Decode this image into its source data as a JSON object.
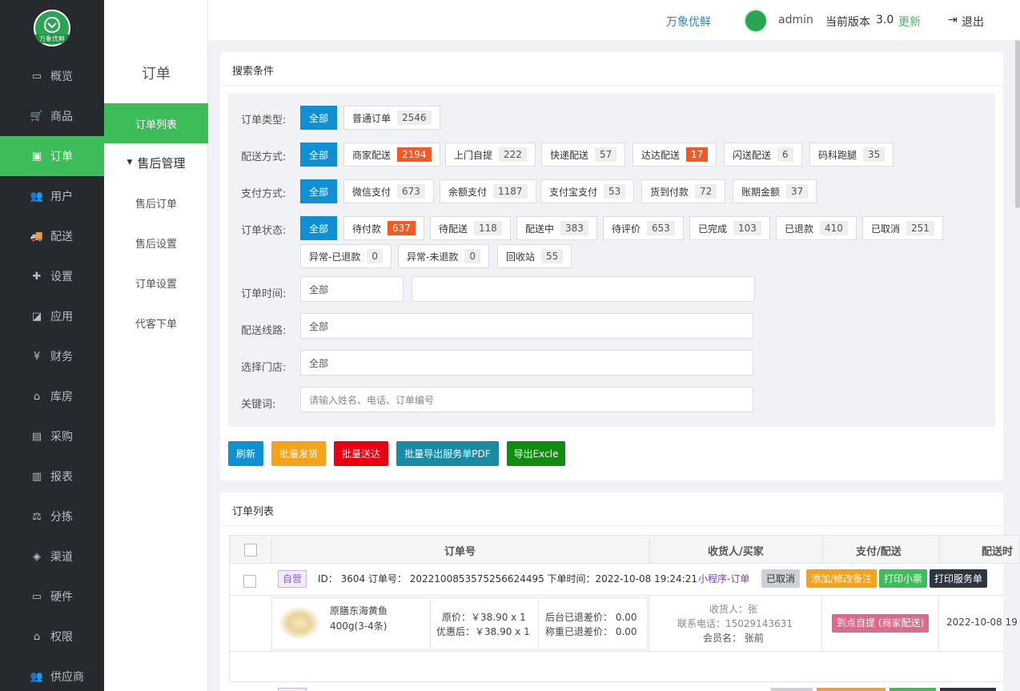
{
  "brand": {
    "logo_text": "万象优鲜"
  },
  "sidebar": {
    "items": [
      {
        "label": "概览",
        "icon": "monitor-icon",
        "glyph": "▭"
      },
      {
        "label": "商品",
        "icon": "cart-icon",
        "glyph": "🛒"
      },
      {
        "label": "订单",
        "icon": "money-icon",
        "glyph": "▣"
      },
      {
        "label": "用户",
        "icon": "users-icon",
        "glyph": "👥"
      },
      {
        "label": "配送",
        "icon": "truck-icon",
        "glyph": "🚚"
      },
      {
        "label": "设置",
        "icon": "puzzle-icon",
        "glyph": "✚"
      },
      {
        "label": "应用",
        "icon": "apps-icon",
        "glyph": "◪"
      },
      {
        "label": "财务",
        "icon": "yen-icon",
        "glyph": "¥"
      },
      {
        "label": "库房",
        "icon": "home-icon",
        "glyph": "⌂"
      },
      {
        "label": "采购",
        "icon": "bus-icon",
        "glyph": "▤"
      },
      {
        "label": "报表",
        "icon": "bar-chart-icon",
        "glyph": "▥"
      },
      {
        "label": "分拣",
        "icon": "scale-icon",
        "glyph": "⚖"
      },
      {
        "label": "渠道",
        "icon": "cube-icon",
        "glyph": "◈"
      },
      {
        "label": "硬件",
        "icon": "desktop-icon",
        "glyph": "▭"
      },
      {
        "label": "权限",
        "icon": "bank-icon",
        "glyph": "⌂"
      },
      {
        "label": "供应商",
        "icon": "users-icon",
        "glyph": "👥"
      }
    ]
  },
  "subnav": {
    "title": "订单",
    "items": [
      {
        "label": "订单列表"
      },
      {
        "label": "售后管理"
      },
      {
        "label": "售后订单"
      },
      {
        "label": "售后设置"
      },
      {
        "label": "订单设置"
      },
      {
        "label": "代客下单"
      }
    ]
  },
  "topbar": {
    "shop": "万象优鲜",
    "user": "admin",
    "version_label": "当前版本",
    "version": "3.0",
    "update": "更新",
    "logout": "退出"
  },
  "search": {
    "title": "搜索条件",
    "order_type": {
      "label": "订单类型:",
      "options": [
        {
          "text": "全部"
        },
        {
          "text": "普通订单",
          "count": "2546"
        }
      ]
    },
    "delivery": {
      "label": "配送方式:",
      "options": [
        {
          "text": "全部"
        },
        {
          "text": "商家配送",
          "count": "2194"
        },
        {
          "text": "上门自提",
          "count": "222"
        },
        {
          "text": "快递配送",
          "count": "57"
        },
        {
          "text": "达达配送",
          "count": "17"
        },
        {
          "text": "闪送配送",
          "count": "6"
        },
        {
          "text": "码科跑腿",
          "count": "35"
        }
      ]
    },
    "payment": {
      "label": "支付方式:",
      "options": [
        {
          "text": "全部"
        },
        {
          "text": "微信支付",
          "count": "673"
        },
        {
          "text": "余额支付",
          "count": "1187"
        },
        {
          "text": "支付宝支付",
          "count": "53"
        },
        {
          "text": "货到付款",
          "count": "72"
        },
        {
          "text": "账期金额",
          "count": "37"
        }
      ]
    },
    "status": {
      "label": "订单状态:",
      "options": [
        {
          "text": "全部"
        },
        {
          "text": "待付款",
          "count": "637"
        },
        {
          "text": "待配送",
          "count": "118"
        },
        {
          "text": "配送中",
          "count": "383"
        },
        {
          "text": "待评价",
          "count": "653"
        },
        {
          "text": "已完成",
          "count": "103"
        },
        {
          "text": "已退款",
          "count": "410"
        },
        {
          "text": "已取消",
          "count": "251"
        },
        {
          "text": "异常-已退款",
          "count": "0"
        },
        {
          "text": "异常-未退款",
          "count": "0"
        },
        {
          "text": "回收站",
          "count": "55"
        }
      ]
    },
    "time": {
      "label": "订单时间:",
      "value": "全部"
    },
    "route": {
      "label": "配送线路:",
      "value": "全部"
    },
    "store": {
      "label": "选择门店:",
      "value": "全部"
    },
    "keyword": {
      "label": "关键词:",
      "placeholder": "请输入姓名、电话、订单编号"
    }
  },
  "actions": {
    "refresh": "刷新",
    "batch_ship": "批量发货",
    "batch_deliver": "批量送达",
    "export_pdf": "批量导出服务单PDF",
    "export_excel": "导出Excle"
  },
  "list": {
    "title": "订单列表",
    "headers": {
      "order_no": "订单号",
      "receiver": "收货人/买家",
      "pay": "支付/配送",
      "delivery_time": "配送时"
    },
    "order": {
      "self_tag": "自营",
      "id_text": "ID： 3604 订单号： 2022100853575256624495 下单时间：2022-10-08 19:24:21",
      "channel": "小程序-订单",
      "status": "已取消",
      "btn_note": "添加/修改备注",
      "btn_ticket": "打印小票",
      "btn_service": "打印服务单",
      "product": {
        "name": "原膳东海黄鱼",
        "spec": "400g(3-4条)",
        "orig": "原价：￥38.90 x 1",
        "disc": "优惠后：￥38.90 x 1",
        "refund1": "后台已退差价： 0.00",
        "refund2": "称重已退差价： 0.00"
      },
      "receiver": {
        "name": "收货人：张",
        "phone": "联系电话：15029143631",
        "member": "会员名： 张前"
      },
      "pay_tag": "到点自提 (商家配送)",
      "delivery_time": "2022-10-08 19"
    }
  }
}
